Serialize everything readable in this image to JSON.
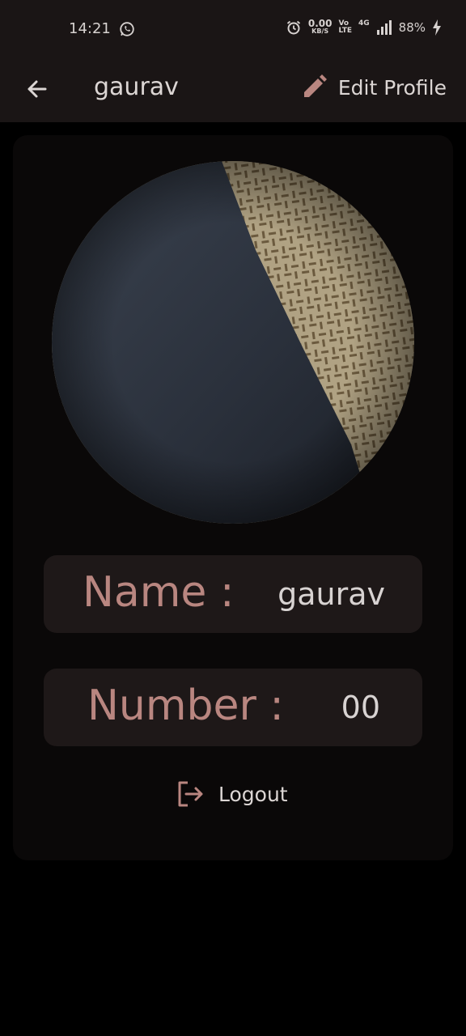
{
  "status_bar": {
    "time": "14:21",
    "net_speed_value": "0.00",
    "net_speed_unit": "KB/S",
    "volte_top": "Vo",
    "volte_bottom": "LTE",
    "network": "4G",
    "battery": "88%",
    "icons": [
      "whatsapp-icon",
      "alarm-icon",
      "signal-icon",
      "charging-icon"
    ]
  },
  "app_bar": {
    "back_icon": "arrow-left-icon",
    "title": "gaurav",
    "edit_icon": "pencil-icon",
    "edit_label": "Edit Profile"
  },
  "profile": {
    "name_label": "Name :",
    "name_value": "gaurav",
    "number_label": "Number :",
    "number_value": "00",
    "logout_icon": "logout-icon",
    "logout_label": "Logout"
  },
  "colors": {
    "accent": "#b98680",
    "background": "#000000",
    "surface": "#1a1515",
    "card": "#0a0808",
    "field": "#1e1818"
  }
}
